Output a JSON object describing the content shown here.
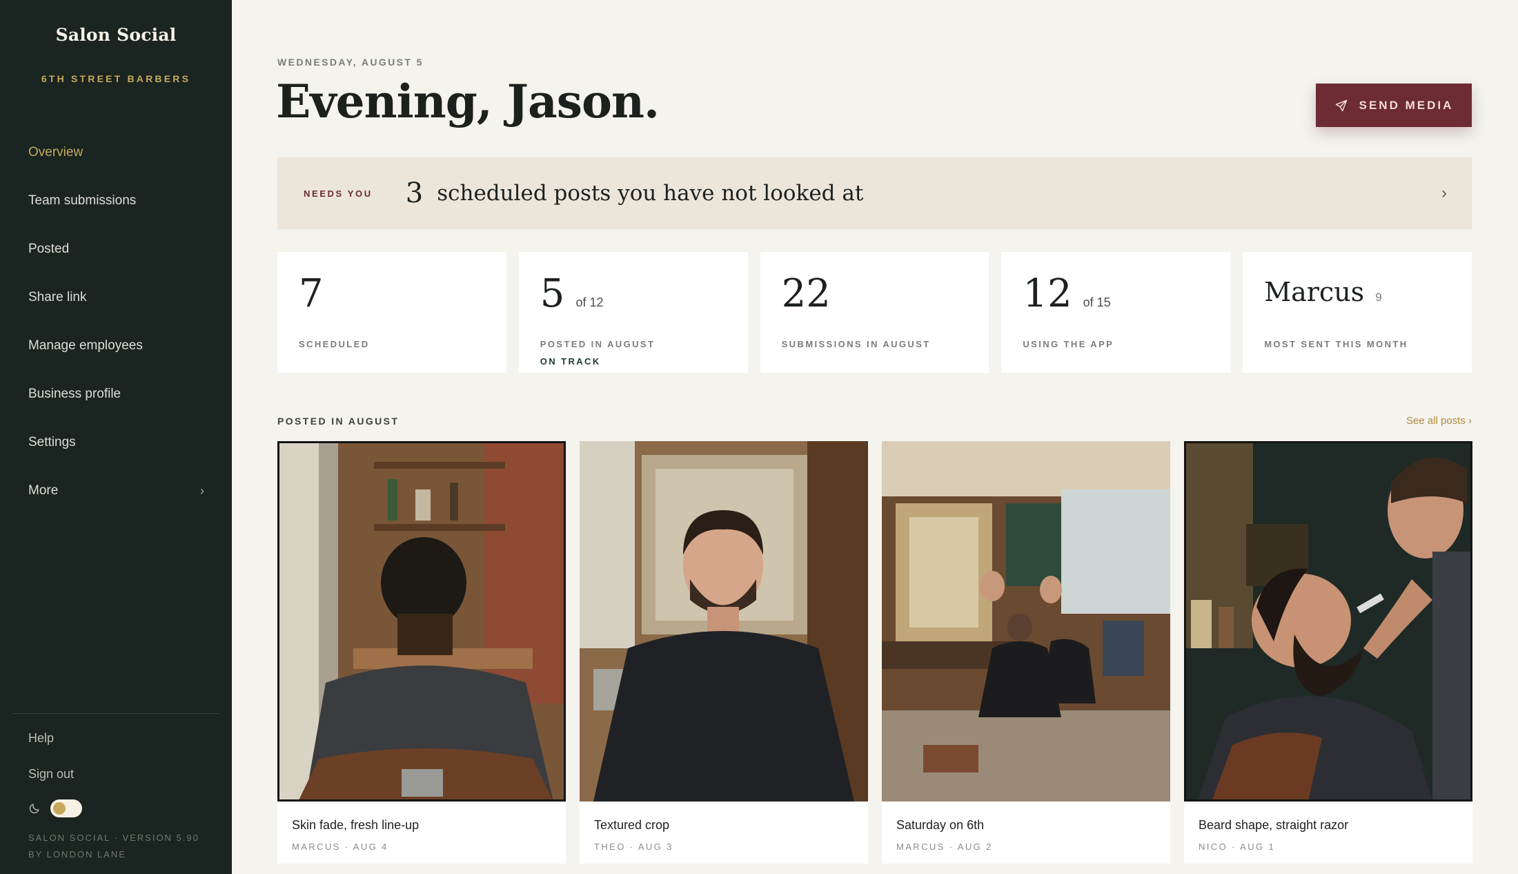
{
  "sidebar": {
    "brand": "Salon Social",
    "shop": "6TH STREET BARBERS",
    "items": [
      {
        "label": "Overview"
      },
      {
        "label": "Team submissions"
      },
      {
        "label": "Posted"
      },
      {
        "label": "Share link"
      },
      {
        "label": "Manage employees"
      },
      {
        "label": "Business profile"
      },
      {
        "label": "Settings"
      },
      {
        "label": "More",
        "chevron": "›"
      }
    ],
    "help": "Help",
    "signout": "Sign out",
    "version_line1": "SALON SOCIAL · VERSION 5.90",
    "version_line2": "BY LONDON LANE",
    "theme_toggle_on": true
  },
  "header": {
    "date": "WEDNESDAY, AUGUST 5",
    "greeting": "Evening, Jason.",
    "send_label": "SEND MEDIA"
  },
  "needs": {
    "tag": "NEEDS YOU",
    "count": "3",
    "text": "scheduled posts you have not looked at",
    "chevron": "›"
  },
  "stats": [
    {
      "value": "7",
      "sub": "",
      "label": "SCHEDULED",
      "note": ""
    },
    {
      "value": "5",
      "sub": "of 12",
      "label": "POSTED IN AUGUST",
      "note": "ON TRACK"
    },
    {
      "value": "22",
      "sub": "",
      "label": "SUBMISSIONS IN AUGUST",
      "note": ""
    },
    {
      "value": "12",
      "sub": "of 15",
      "label": "USING THE APP",
      "note": ""
    },
    {
      "value": "Marcus",
      "sub": "9",
      "label": "MOST SENT THIS MONTH",
      "note": ""
    }
  ],
  "posted": {
    "title": "POSTED IN AUGUST",
    "see_all": "See all posts ›",
    "posts": [
      {
        "title": "Skin fade, fresh line-up",
        "meta": "MARCUS · AUG 4"
      },
      {
        "title": "Textured crop",
        "meta": "THEO · AUG 3"
      },
      {
        "title": "Saturday on 6th",
        "meta": "MARCUS · AUG 2"
      },
      {
        "title": "Beard shape, straight razor",
        "meta": "NICO · AUG 1"
      }
    ]
  },
  "colors": {
    "sidebar_bg": "#1a2420",
    "accent_gold": "#c6a95c",
    "button_bg": "#6d2b33",
    "page_bg": "#f4f3ee",
    "banner_bg": "#ebe5da"
  },
  "icons": {
    "send": "send-icon",
    "theme": "moon-icon",
    "chevron": "chevron-right-icon"
  }
}
